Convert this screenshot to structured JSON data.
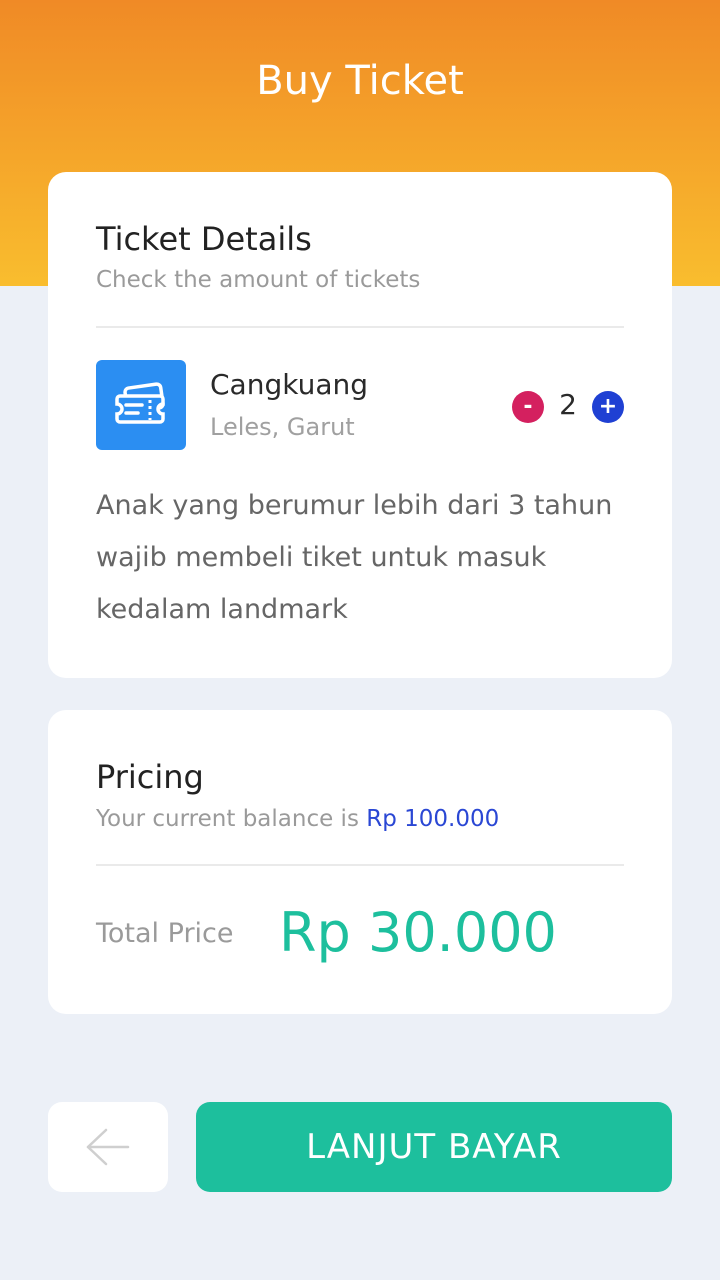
{
  "header": {
    "title": "Buy Ticket"
  },
  "ticket_details": {
    "title": "Ticket Details",
    "subtitle": "Check the amount of tickets",
    "item": {
      "name": "Cangkuang",
      "location": "Leles, Garut",
      "icon": "ticket-icon",
      "quantity": "2",
      "minus_label": "-",
      "plus_label": "+"
    },
    "description": "Anak yang berumur lebih dari 3 tahun wajib membeli tiket untuk masuk kedalam landmark"
  },
  "pricing": {
    "title": "Pricing",
    "balance_prefix": "Your current balance is ",
    "balance_amount": "Rp 100.000",
    "total_label": "Total Price",
    "total_value": "Rp 30.000"
  },
  "actions": {
    "back_icon": "arrow-left-icon",
    "pay_label": "LANJUT BAYAR"
  },
  "colors": {
    "header_gradient_top": "#f08a26",
    "header_gradient_bottom": "#f9bd2e",
    "accent_green": "#1dbf9d",
    "accent_blue": "#1f40d3",
    "accent_pink": "#d4205f",
    "icon_blue": "#2b8ef2"
  }
}
